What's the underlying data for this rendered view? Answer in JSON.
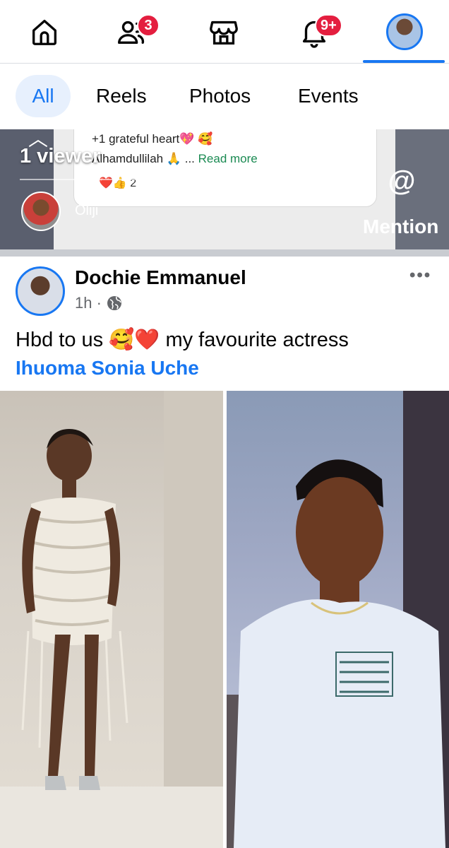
{
  "nav": {
    "friends_badge": "3",
    "notifications_badge": "9+"
  },
  "filters": {
    "all": "All",
    "reels": "Reels",
    "photos": "Photos",
    "events": "Events"
  },
  "story": {
    "viewer_text": "1 viewer",
    "line1": "+1 grateful heart💖 🥰",
    "line2_prefix": "Alhamdullilah 🙏 ...",
    "line2_link": "Read more",
    "reactions": "❤️👍 2",
    "author": "Oliji",
    "mention_label": "Mention"
  },
  "post": {
    "author": "Dochie Emmanuel",
    "time": "1h ·",
    "text": "Hbd to us 🥰❤️ my favourite actress",
    "tag": "Ihuoma Sonia Uche",
    "more": "•••"
  },
  "colors": {
    "accent": "#1877f2",
    "badge": "#e41e3f"
  }
}
